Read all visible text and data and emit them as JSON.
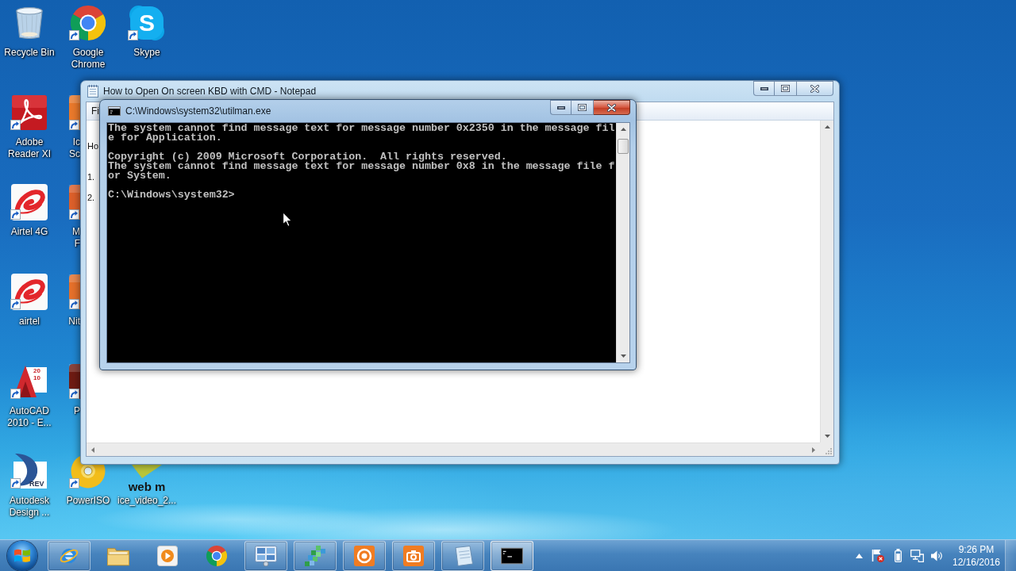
{
  "desktop": {
    "icons": [
      {
        "label": "Recycle Bin",
        "kind": "bin",
        "shortcut": false
      },
      {
        "label": "Google Chrome",
        "kind": "wheel",
        "shortcut": true
      },
      {
        "label": "Skype",
        "kind": "cloud",
        "glyph": "S",
        "shortcut": true
      },
      {
        "label": "Adobe Reader XI",
        "kind": "document",
        "shortcut": true
      },
      {
        "label": "Ic Sc",
        "kind": "partial",
        "shortcut": true
      },
      {
        "label": "Airtel 4G",
        "kind": "swirl",
        "shortcut": true
      },
      {
        "label": "M F",
        "kind": "partial",
        "shortcut": true
      },
      {
        "label": "airtel",
        "kind": "swirl",
        "shortcut": true
      },
      {
        "label": "Nit",
        "kind": "partial",
        "shortcut": true
      },
      {
        "label": "AutoCAD 2010 - E...",
        "kind": "pyramid",
        "glyph": "20 10",
        "shortcut": true
      },
      {
        "label": "P",
        "kind": "partial",
        "shortcut": true
      },
      {
        "label": "Autodesk Design ...",
        "kind": "swoosh",
        "glyph": "REV",
        "shortcut": true
      },
      {
        "label": "PowerISO",
        "kind": "disc",
        "shortcut": true
      },
      {
        "label": "ice_video_2...",
        "kind": "video",
        "glyph": "web m",
        "shortcut": false
      }
    ]
  },
  "notepad": {
    "title": "How to Open On screen KBD with CMD - Notepad",
    "active": false,
    "menu": [
      "Fi"
    ],
    "lines": [
      "Ho",
      "1.",
      "2."
    ]
  },
  "console": {
    "title": "C:\\Windows\\system32\\utilman.exe",
    "active": true,
    "blocks": [
      [
        "The system cannot find message text for message number 0x2350 in the message fil",
        "e for Application."
      ],
      [
        "Copyright (c) 2009 Microsoft Corporation.  All rights reserved.",
        "The system cannot find message text for message number 0x8 in the message file f",
        "or System."
      ],
      [
        "C:\\Windows\\system32>"
      ]
    ]
  },
  "taskbar": {
    "buttons": [
      {
        "kind": "orbit",
        "running": true,
        "selected": false
      },
      {
        "kind": "folder",
        "running": false,
        "selected": false
      },
      {
        "kind": "player",
        "running": false,
        "selected": false
      },
      {
        "kind": "wheel",
        "running": false,
        "selected": false
      },
      {
        "kind": "panel",
        "running": true,
        "selected": false
      },
      {
        "kind": "cubes",
        "running": true,
        "selected": false
      },
      {
        "kind": "record",
        "running": true,
        "selected": false
      },
      {
        "kind": "camera",
        "running": true,
        "selected": false
      },
      {
        "kind": "notepad",
        "running": true,
        "selected": false
      },
      {
        "kind": "terminal",
        "running": true,
        "selected": true
      }
    ],
    "clock": {
      "time": "9:26 PM",
      "date": "12/16/2016"
    }
  }
}
